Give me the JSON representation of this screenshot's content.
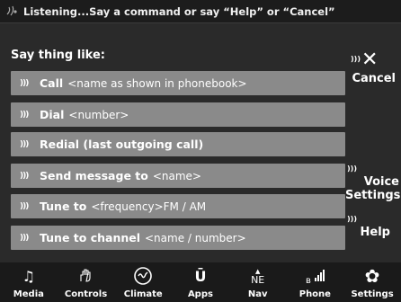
{
  "status": {
    "text": "Listening...Say a command or say “Help” or “Cancel”"
  },
  "panel": {
    "title": "Say thing like:"
  },
  "commands": [
    {
      "main": "Call",
      "sub": "<name as shown in phonebook>"
    },
    {
      "main": "Dial",
      "sub": "<number>"
    },
    {
      "main": "Redial (last outgoing call)",
      "sub": ""
    },
    {
      "main": "Send message to",
      "sub": "<name>"
    },
    {
      "main": "Tune to",
      "sub": "<frequency>FM / AM"
    },
    {
      "main": "Tune to channel",
      "sub": "<name / number>"
    }
  ],
  "side": {
    "cancel": "Cancel",
    "voice_settings_1": "Voice",
    "voice_settings_2": "Settings",
    "help": "Help"
  },
  "nav": [
    {
      "label": "Media",
      "icon": "music-note-icon"
    },
    {
      "label": "Controls",
      "icon": "hand-controls-icon"
    },
    {
      "label": "Climate",
      "icon": "climate-icon"
    },
    {
      "label": "Apps",
      "icon": "apps-icon"
    },
    {
      "label": "Nav",
      "icon": "compass-icon",
      "glyph": "NE"
    },
    {
      "label": "Phone",
      "icon": "phone-signal-icon"
    },
    {
      "label": "Settings",
      "icon": "gear-icon"
    }
  ],
  "colors": {
    "row_bg": "#8a8a8a",
    "background": "#2a2a2a",
    "bar_bg": "#1a1a1a"
  }
}
